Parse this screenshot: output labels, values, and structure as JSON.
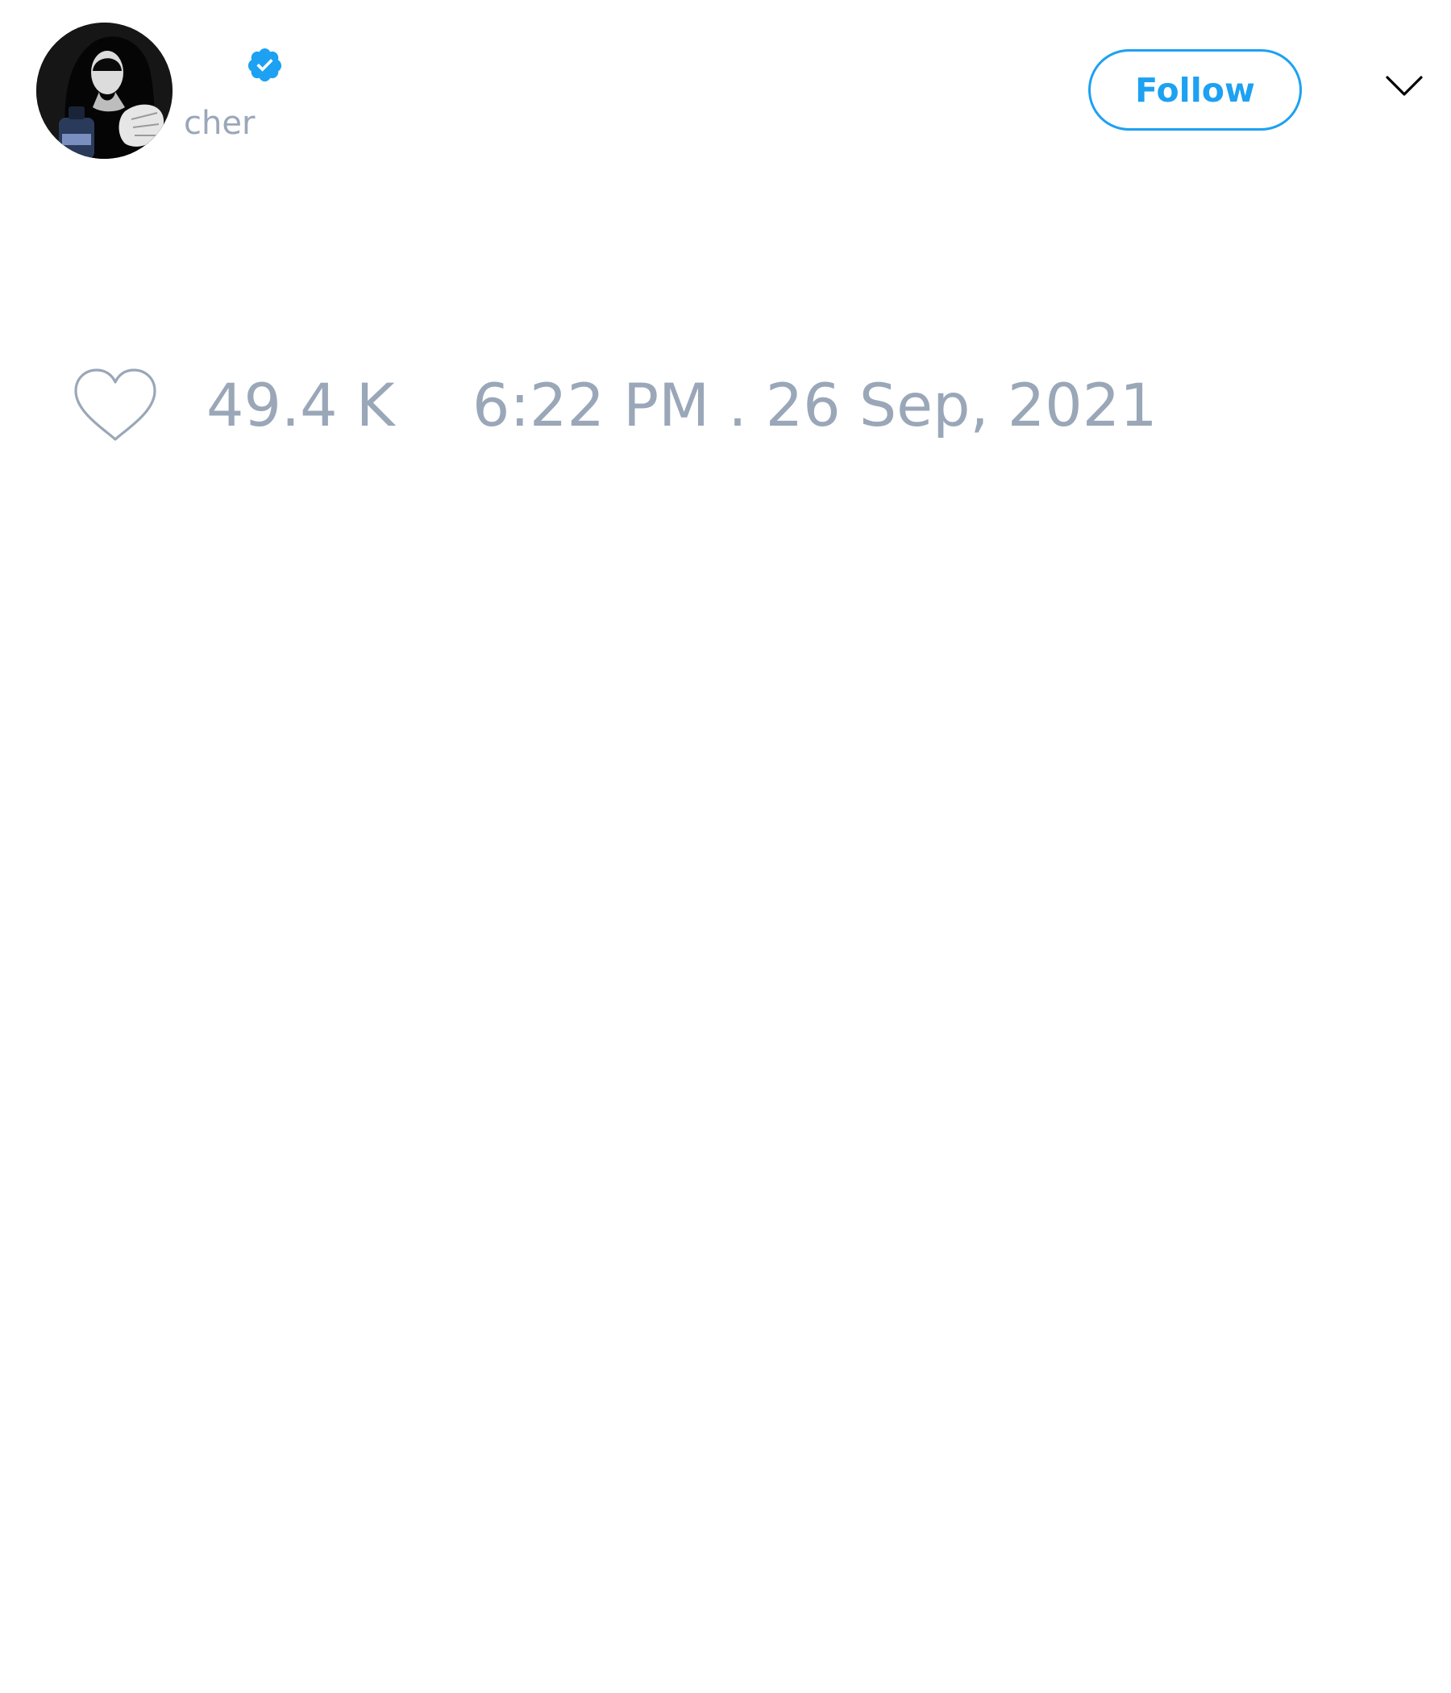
{
  "profile": {
    "handle": "cher",
    "verified_icon": "verified-badge-icon",
    "avatar_icon": "profile-avatar"
  },
  "header": {
    "follow_label": "Follow",
    "menu_icon": "chevron-down-icon"
  },
  "stats": {
    "like_icon": "heart-icon",
    "likes": "49.4 K",
    "timestamp": "6:22 PM . 26 Sep, 2021"
  },
  "colors": {
    "accent": "#1da1f2",
    "muted_text": "#9aa7b8",
    "background": "#ffffff"
  }
}
